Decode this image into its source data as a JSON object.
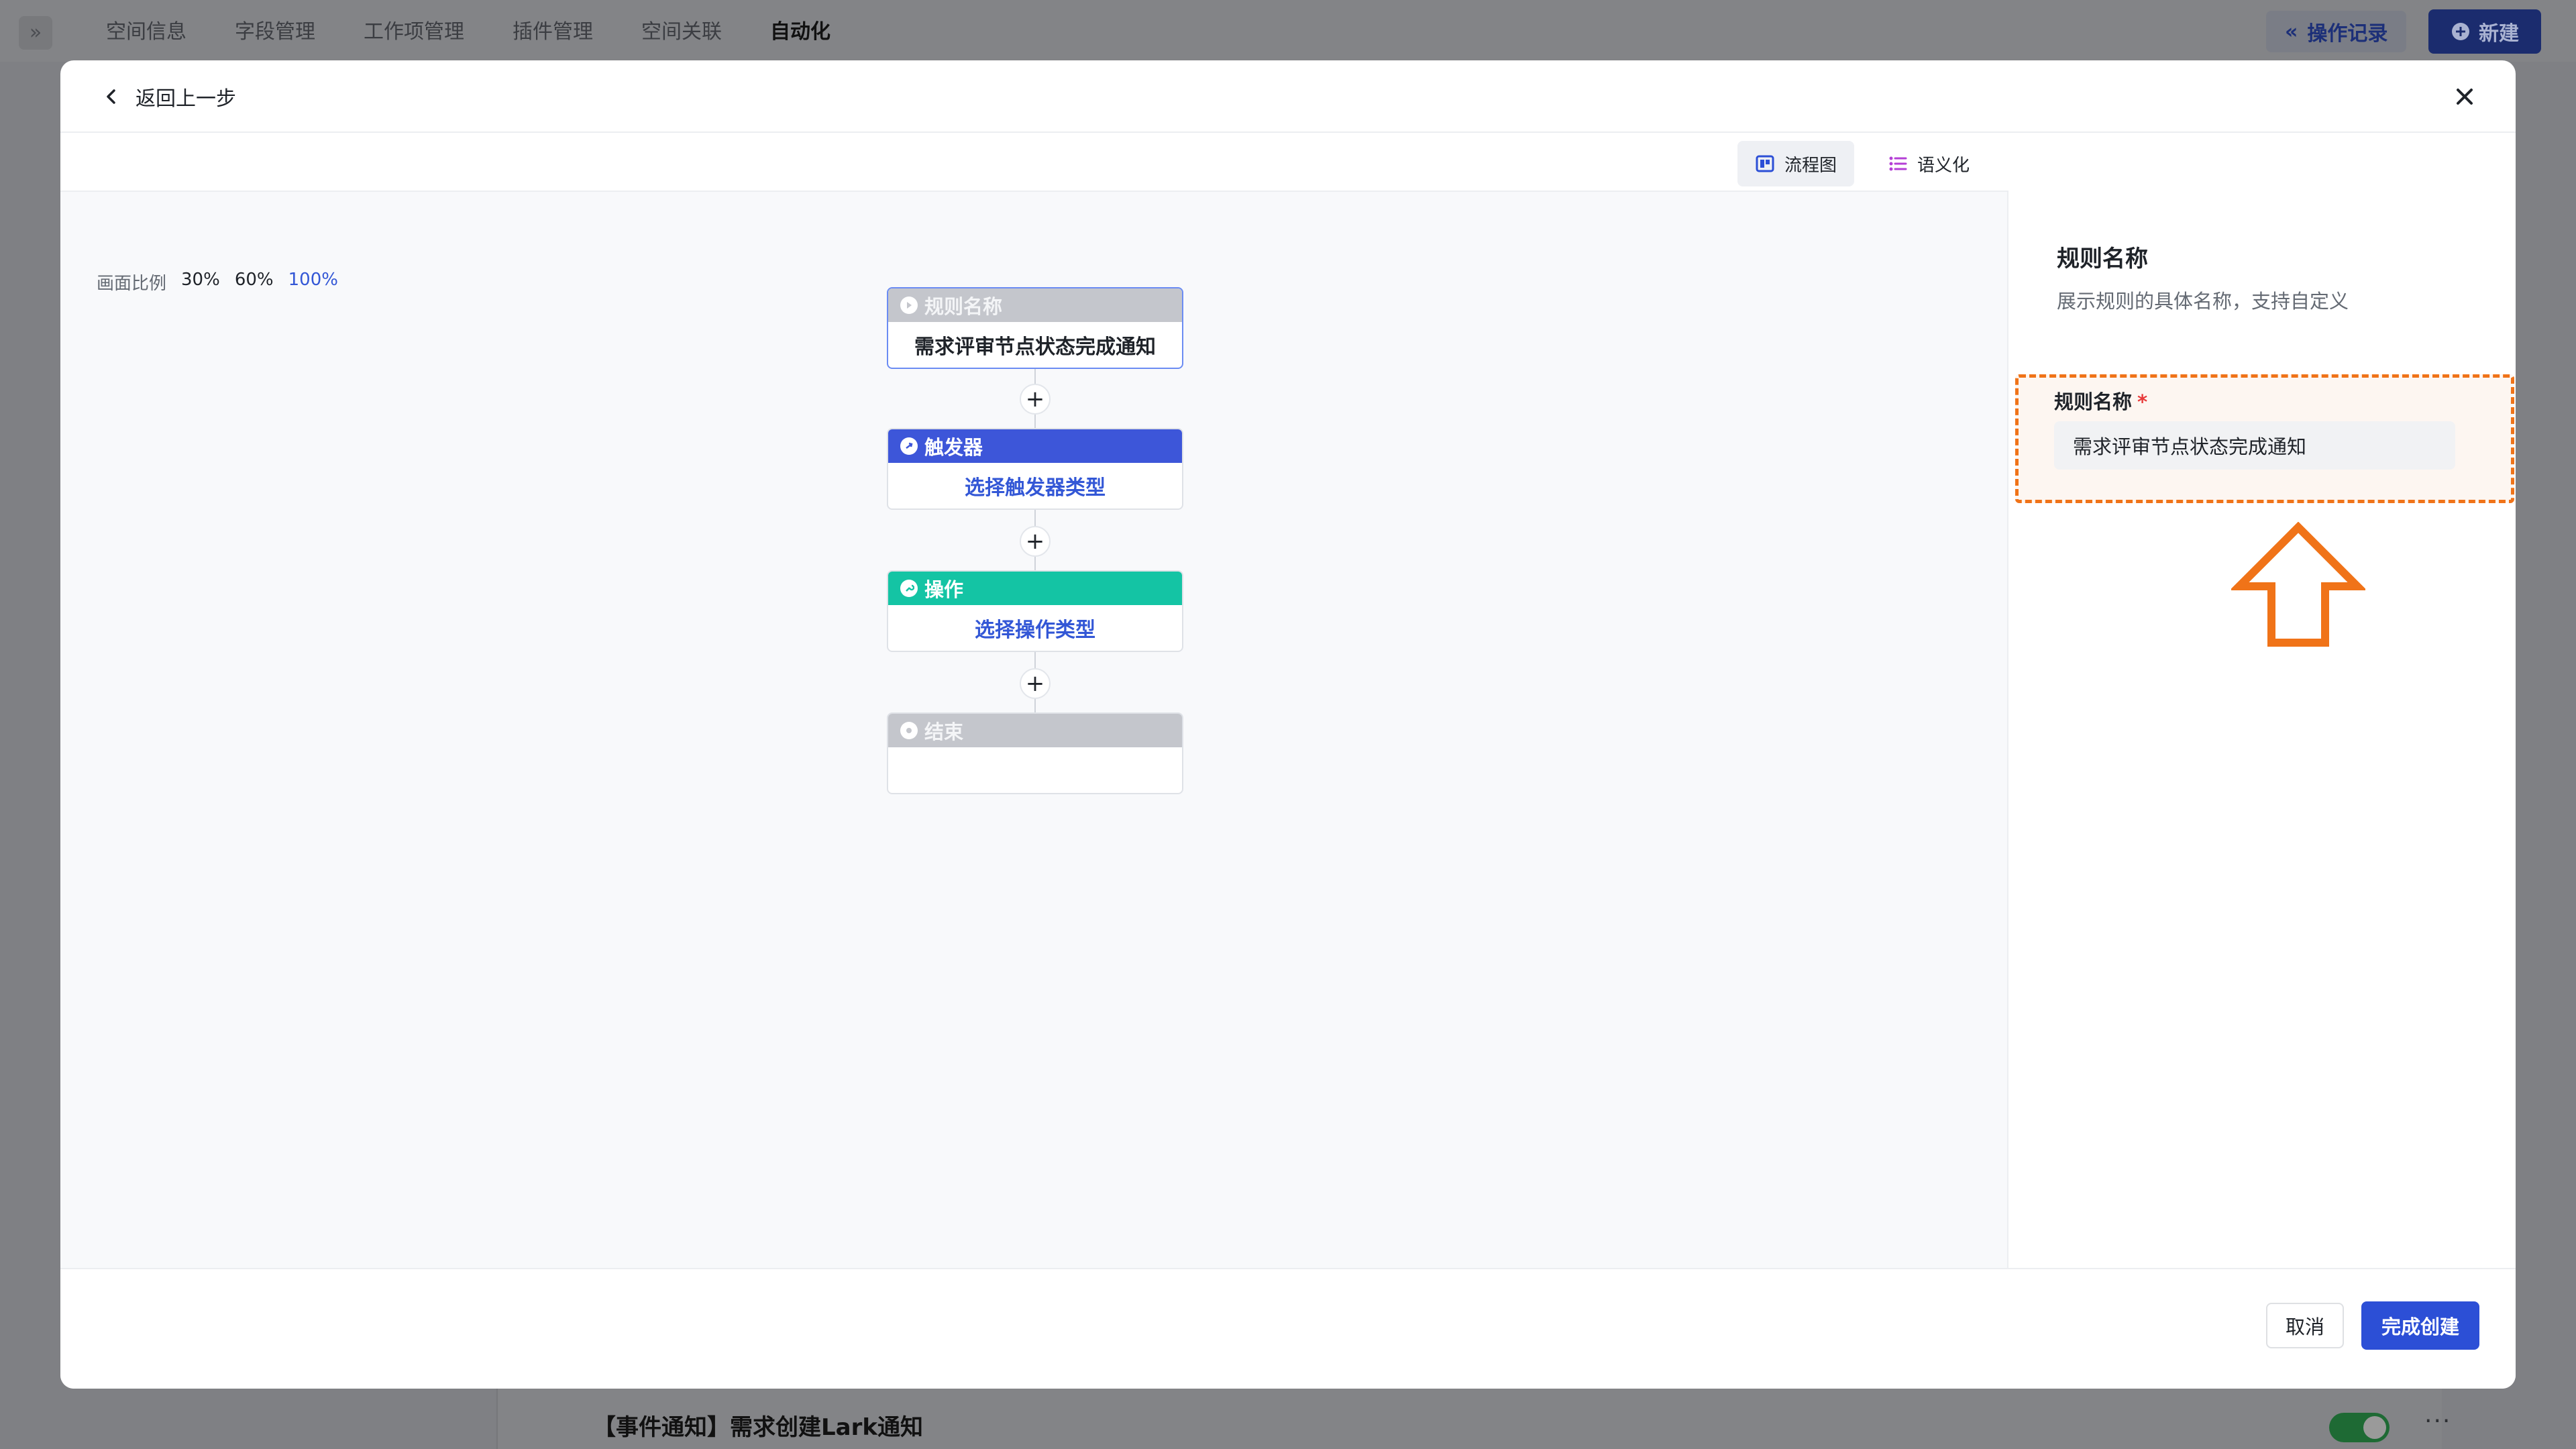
{
  "background": {
    "tabs": [
      "空间信息",
      "字段管理",
      "工作项管理",
      "插件管理",
      "空间关联",
      "自动化"
    ],
    "active_tab": "自动化",
    "op_log_label": "操作记录",
    "new_label": "新建",
    "list_item_title": "【事件通知】需求创建Lark通知"
  },
  "modal": {
    "back_label": "返回上一步",
    "view_flow_label": "流程图",
    "view_semantic_label": "语义化",
    "zoom": {
      "label": "画面比例",
      "options": [
        "30%",
        "60%",
        "100%"
      ],
      "active": "100%"
    },
    "nodes": {
      "name": {
        "title": "规则名称",
        "value": "需求评审节点状态完成通知"
      },
      "trigger": {
        "title": "触发器",
        "value": "选择触发器类型"
      },
      "action": {
        "title": "操作",
        "value": "选择操作类型"
      },
      "end": {
        "title": "结束",
        "value": ""
      }
    },
    "panel": {
      "title": "规则名称",
      "description": "展示规则的具体名称，支持自定义",
      "field_label": "规则名称",
      "required_mark": "*",
      "field_value": "需求评审节点状态完成通知"
    },
    "footer": {
      "cancel_label": "取消",
      "confirm_label": "完成创建"
    }
  },
  "colors": {
    "primary": "#2c4fd6",
    "trigger": "#3d56d9",
    "action": "#14c4a4",
    "highlight": "#f07318"
  }
}
